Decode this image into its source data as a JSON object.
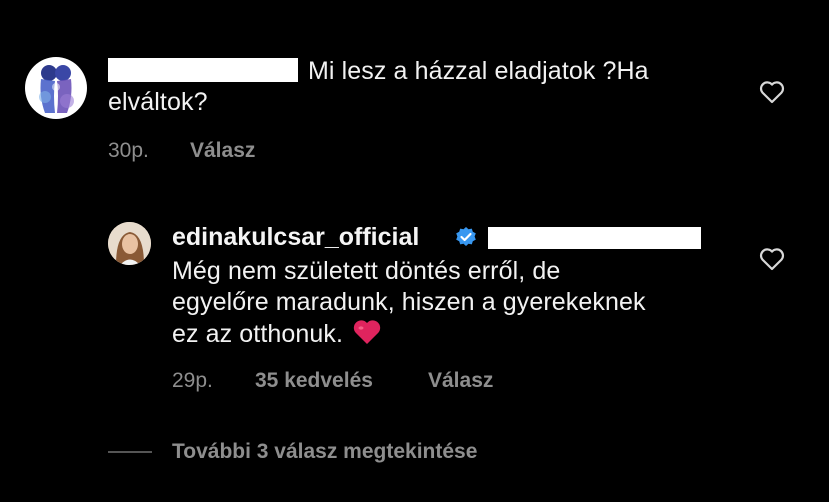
{
  "comment": {
    "text_line1": "Mi lesz a házzal eladjatok ?Ha",
    "text_line2": "elváltok?",
    "time": "30p.",
    "reply_label": "Válasz",
    "avatar_icon": "watercolor-girls-avatar",
    "like_icon": "heart-outline-icon"
  },
  "reply": {
    "username": "edinakulcsar_official",
    "verified_icon": "verified-badge-icon",
    "text_line1": "Még nem született döntés erről, de",
    "text_line2": "egyelőre maradunk, hiszen a gyerekeknek",
    "text_line3": "ez az otthonuk.",
    "emoji": "red-heart-emoji",
    "time": "29p.",
    "likes": "35 kedvelés",
    "reply_label": "Válasz",
    "avatar_icon": "profile-photo-avatar",
    "like_icon": "heart-outline-icon"
  },
  "more_replies": {
    "label": "További 3 válasz megtekintése"
  },
  "colors": {
    "background": "#000000",
    "text": "#f5f5f5",
    "muted": "#8e8e8e",
    "verified": "#3897f0",
    "heart_emoji": "#e0245e"
  }
}
